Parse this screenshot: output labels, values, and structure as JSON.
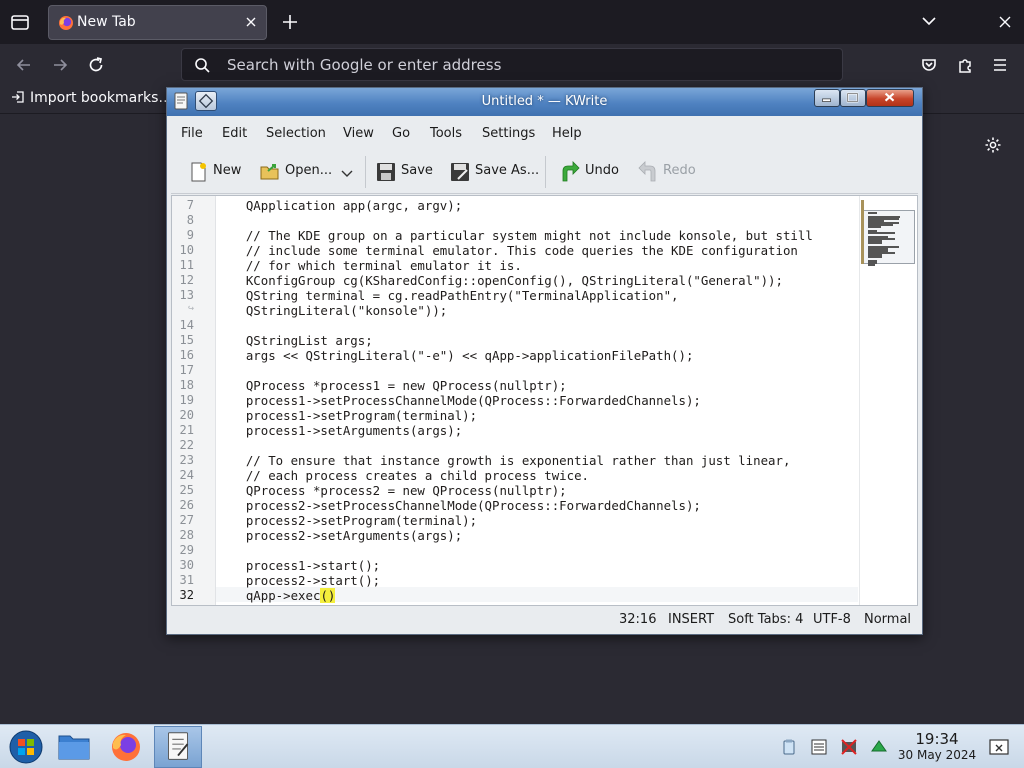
{
  "browser": {
    "tab_title": "New Tab",
    "url_placeholder": "Search with Google or enter address",
    "bookmark_item": "Import bookmarks…"
  },
  "kwrite": {
    "window_title": "Untitled * — KWrite",
    "menu": [
      "File",
      "Edit",
      "Selection",
      "View",
      "Go",
      "Tools",
      "Settings",
      "Help"
    ],
    "toolbar": {
      "new": "New",
      "open": "Open...",
      "save": "Save",
      "save_as": "Save As...",
      "undo": "Undo",
      "redo": "Redo"
    },
    "lines": [
      {
        "num": "7",
        "text": "    QApplication app(argc, argv);"
      },
      {
        "num": "8",
        "text": ""
      },
      {
        "num": "9",
        "text": "    // The KDE group on a particular system might not include konsole, but still"
      },
      {
        "num": "10",
        "text": "    // include some terminal emulator. This code queries the KDE configuration"
      },
      {
        "num": "11",
        "text": "    // for which terminal emulator it is."
      },
      {
        "num": "12",
        "text": "    KConfigGroup cg(KSharedConfig::openConfig(), QStringLiteral(\"General\"));"
      },
      {
        "num": "13",
        "text": "    QString terminal = cg.readPathEntry(\"TerminalApplication\","
      },
      {
        "num": "↪",
        "text": "    QStringLiteral(\"konsole\"));"
      },
      {
        "num": "14",
        "text": ""
      },
      {
        "num": "15",
        "text": "    QStringList args;"
      },
      {
        "num": "16",
        "text": "    args << QStringLiteral(\"-e\") << qApp->applicationFilePath();"
      },
      {
        "num": "17",
        "text": ""
      },
      {
        "num": "18",
        "text": "    QProcess *process1 = new QProcess(nullptr);"
      },
      {
        "num": "19",
        "text": "    process1->setProcessChannelMode(QProcess::ForwardedChannels);"
      },
      {
        "num": "20",
        "text": "    process1->setProgram(terminal);"
      },
      {
        "num": "21",
        "text": "    process1->setArguments(args);"
      },
      {
        "num": "22",
        "text": ""
      },
      {
        "num": "23",
        "text": "    // To ensure that instance growth is exponential rather than just linear,"
      },
      {
        "num": "24",
        "text": "    // each process creates a child process twice."
      },
      {
        "num": "25",
        "text": "    QProcess *process2 = new QProcess(nullptr);"
      },
      {
        "num": "26",
        "text": "    process2->setProcessChannelMode(QProcess::ForwardedChannels);"
      },
      {
        "num": "27",
        "text": "    process2->setProgram(terminal);"
      },
      {
        "num": "28",
        "text": "    process2->setArguments(args);"
      },
      {
        "num": "29",
        "text": ""
      },
      {
        "num": "30",
        "text": "    process1->start();"
      },
      {
        "num": "31",
        "text": "    process2->start();"
      }
    ],
    "current_line": {
      "num": "32",
      "pre": "    qApp->exec",
      "mark": "()",
      "post": ""
    },
    "status": {
      "position": "32:16",
      "mode": "INSERT",
      "tabs": "Soft Tabs: 4",
      "encoding": "UTF-8",
      "highlight": "Normal"
    }
  },
  "taskbar": {
    "time": "19:34",
    "date": "30 May 2024"
  }
}
